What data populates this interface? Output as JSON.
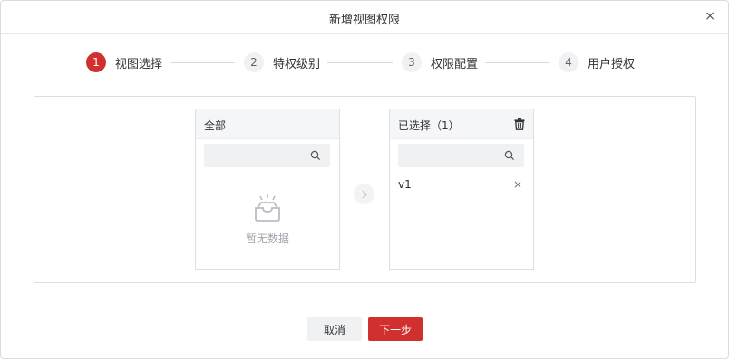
{
  "dialog": {
    "title": "新增视图权限",
    "close": "×"
  },
  "steps": [
    {
      "num": "1",
      "label": "视图选择",
      "active": true
    },
    {
      "num": "2",
      "label": "特权级别",
      "active": false
    },
    {
      "num": "3",
      "label": "权限配置",
      "active": false
    },
    {
      "num": "4",
      "label": "用户授权",
      "active": false
    }
  ],
  "left_panel": {
    "title": "全部",
    "search_placeholder": "",
    "empty_text": "暂无数据"
  },
  "right_panel": {
    "title": "已选择（1）",
    "search_placeholder": "",
    "items": [
      {
        "label": "v1",
        "remove": "×"
      }
    ]
  },
  "footer": {
    "cancel_label": "取消",
    "next_label": "下一步"
  },
  "colors": {
    "accent": "#d0312f"
  }
}
